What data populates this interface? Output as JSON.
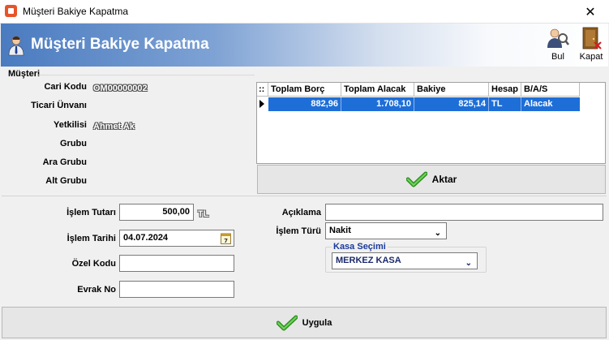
{
  "window": {
    "title": "Müşteri Bakiye Kapatma"
  },
  "banner": {
    "title": "Müşteri Bakiye Kapatma"
  },
  "toolbar": {
    "bul_label": "Bul",
    "kapat_label": "Kapat"
  },
  "musteri": {
    "group_label": "Müşteri",
    "fields": {
      "cari_kodu": {
        "label": "Cari Kodu",
        "value": "OM00000002"
      },
      "ticari_unvani": {
        "label": "Ticari Ünvanı",
        "value": ""
      },
      "yetkilisi": {
        "label": "Yetkilisi",
        "value": "Ahmet Ak"
      },
      "grubu": {
        "label": "Grubu",
        "value": ""
      },
      "ara_grubu": {
        "label": "Ara Grubu",
        "value": ""
      },
      "alt_grubu": {
        "label": "Alt Grubu",
        "value": ""
      }
    }
  },
  "grid": {
    "corner": "::",
    "columns": [
      "Toplam Borç",
      "Toplam Alacak",
      "Bakiye",
      "Hesap",
      "B/A/S"
    ],
    "rows": [
      {
        "toplam_borc": "882,96",
        "toplam_alacak": "1.708,10",
        "bakiye": "825,14",
        "hesap": "TL",
        "bas": "Alacak"
      }
    ]
  },
  "aktar_label": "Aktar",
  "form": {
    "islem_tutari": {
      "label": "İşlem Tutarı",
      "value": "500,00",
      "currency": "TL"
    },
    "islem_tarihi": {
      "label": "İşlem Tarihi",
      "value": "04.07.2024"
    },
    "ozel_kodu": {
      "label": "Özel Kodu",
      "value": ""
    },
    "evrak_no": {
      "label": "Evrak No",
      "value": ""
    },
    "aciklama": {
      "label": "Açıklama",
      "value": ""
    },
    "islem_turu": {
      "label": "İşlem Türü",
      "value": "Nakit"
    },
    "kasa_secimi": {
      "label": "Kasa Seçimi",
      "value": "MERKEZ KASA"
    }
  },
  "uygula_label": "Uygula",
  "colors": {
    "selection": "#1e6ed8",
    "kasa_label": "#1a3a9c",
    "check_green": "#3aa82e"
  },
  "icons": {
    "bul": "search-user-icon",
    "kapat": "exit-door-icon",
    "check": "check-icon",
    "calendar": "calendar-icon"
  }
}
